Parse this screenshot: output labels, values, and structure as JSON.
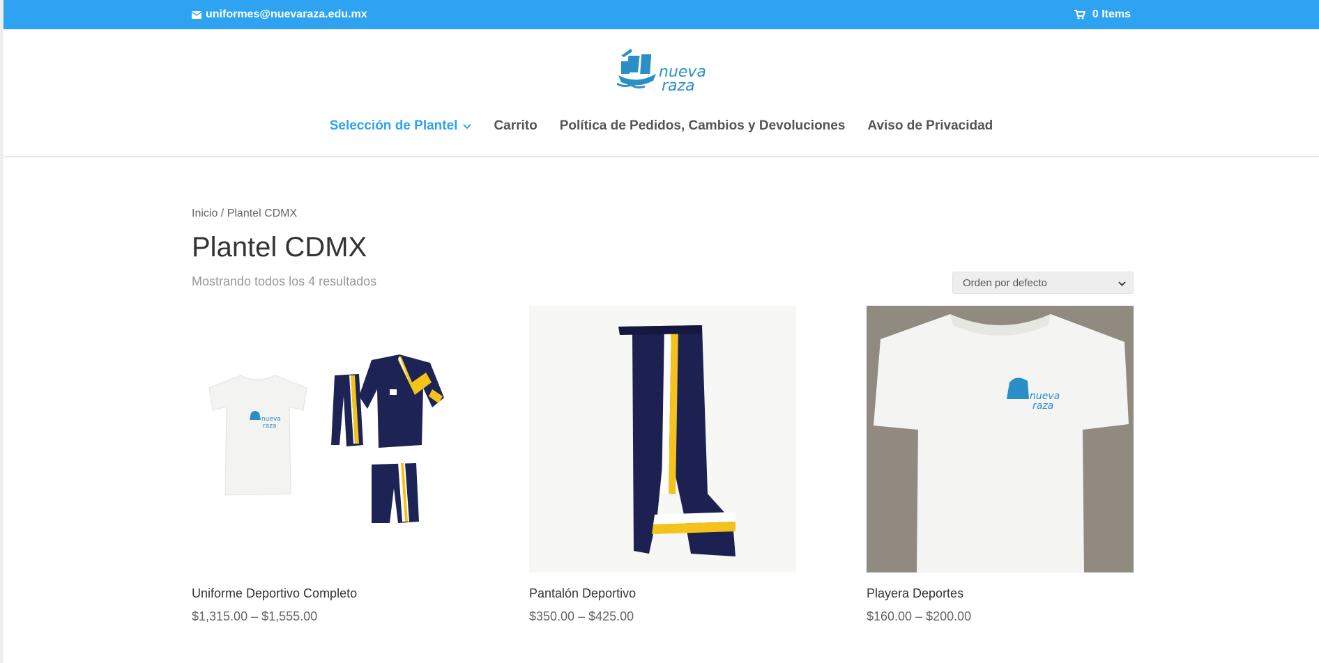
{
  "topbar": {
    "email": "uniformes@nuevaraza.edu.mx",
    "cart_label": "0 Items",
    "color": "#2ea3f2"
  },
  "brand": {
    "logo_line1": "nueva",
    "logo_line2": "raza",
    "color": "#2a8fc7"
  },
  "nav": {
    "items": [
      {
        "label": "Selección de Plantel",
        "active": true,
        "has_dropdown": true
      },
      {
        "label": "Carrito"
      },
      {
        "label": "Política de Pedidos, Cambios y Devoluciones"
      },
      {
        "label": "Aviso de Privacidad"
      }
    ]
  },
  "breadcrumb": {
    "home": "Inicio",
    "separator": " / ",
    "current": "Plantel CDMX"
  },
  "page": {
    "title": "Plantel CDMX",
    "result_count": "Mostrando todos los 4 resultados",
    "orderby": "Orden por defecto"
  },
  "products": [
    {
      "name": "Uniforme Deportivo Completo",
      "price": "$1,315.00 – $1,555.00",
      "image": "full-uniform-set"
    },
    {
      "name": "Pantalón Deportivo",
      "price": "$350.00 – $425.00",
      "image": "sport-pants"
    },
    {
      "name": "Playera Deportes",
      "price": "$160.00 – $200.00",
      "image": "white-tshirt"
    }
  ]
}
